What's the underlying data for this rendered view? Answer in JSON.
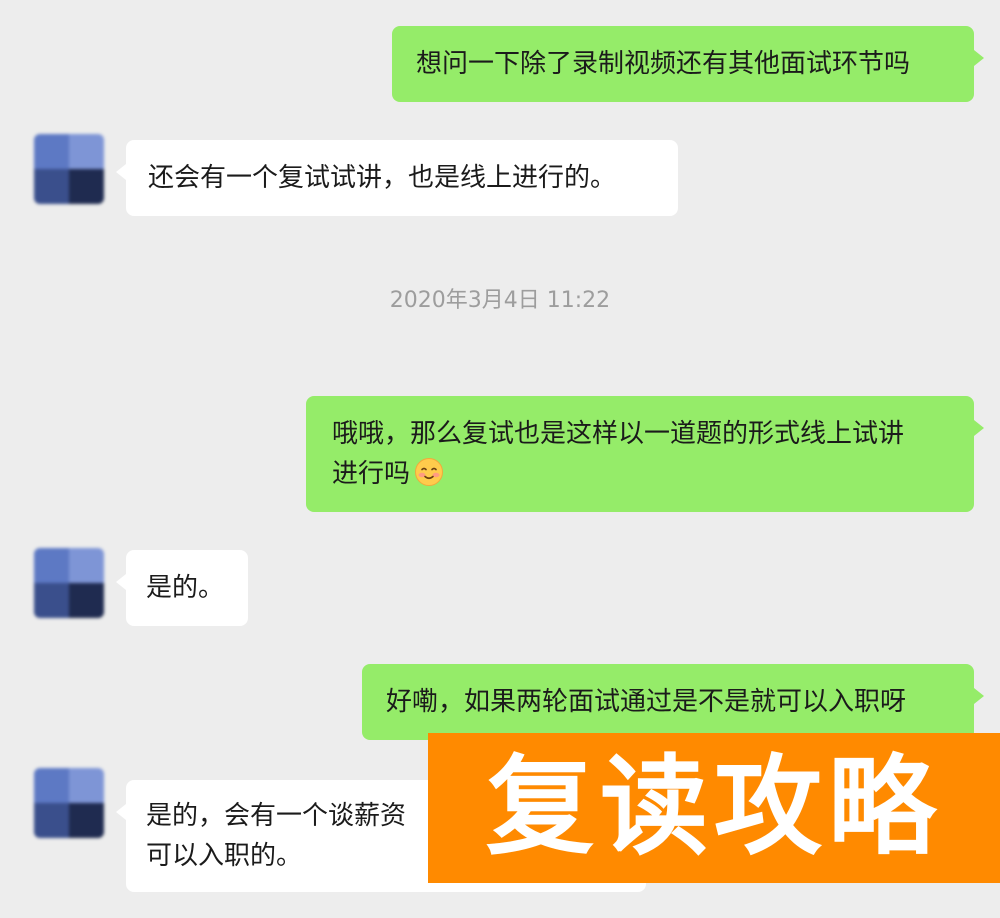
{
  "messages": [
    {
      "side": "me",
      "lines": [
        "想问一下除了录制视频还有其他面试环节吗"
      ]
    },
    {
      "side": "them",
      "lines": [
        "还会有一个复试试讲，也是线上进行的。"
      ]
    },
    {
      "side": "me",
      "lines": [
        "哦哦，那么复试也是这样以一道题的形式线上试讲",
        "进行吗"
      ],
      "emoji": "blush-smile-emoji"
    },
    {
      "side": "them",
      "lines": [
        "是的。"
      ]
    },
    {
      "side": "me",
      "lines": [
        "好嘞，如果两轮面试通过是不是就可以入职呀"
      ]
    },
    {
      "side": "them",
      "lines": [
        "是的，会有一个谈薪资",
        "可以入职的。"
      ]
    }
  ],
  "timestamp": "2020年3月4日 11:22",
  "overlay": {
    "text": "复读攻略",
    "background": "#ff8a00",
    "color": "#ffffff"
  },
  "colors": {
    "background": "#ededed",
    "my_bubble": "#95ec69",
    "their_bubble": "#ffffff",
    "timestamp_text": "#9d9d9d"
  },
  "icons": {
    "avatar": "contact-avatar-blurred",
    "emoji": "blush-smile-emoji"
  }
}
